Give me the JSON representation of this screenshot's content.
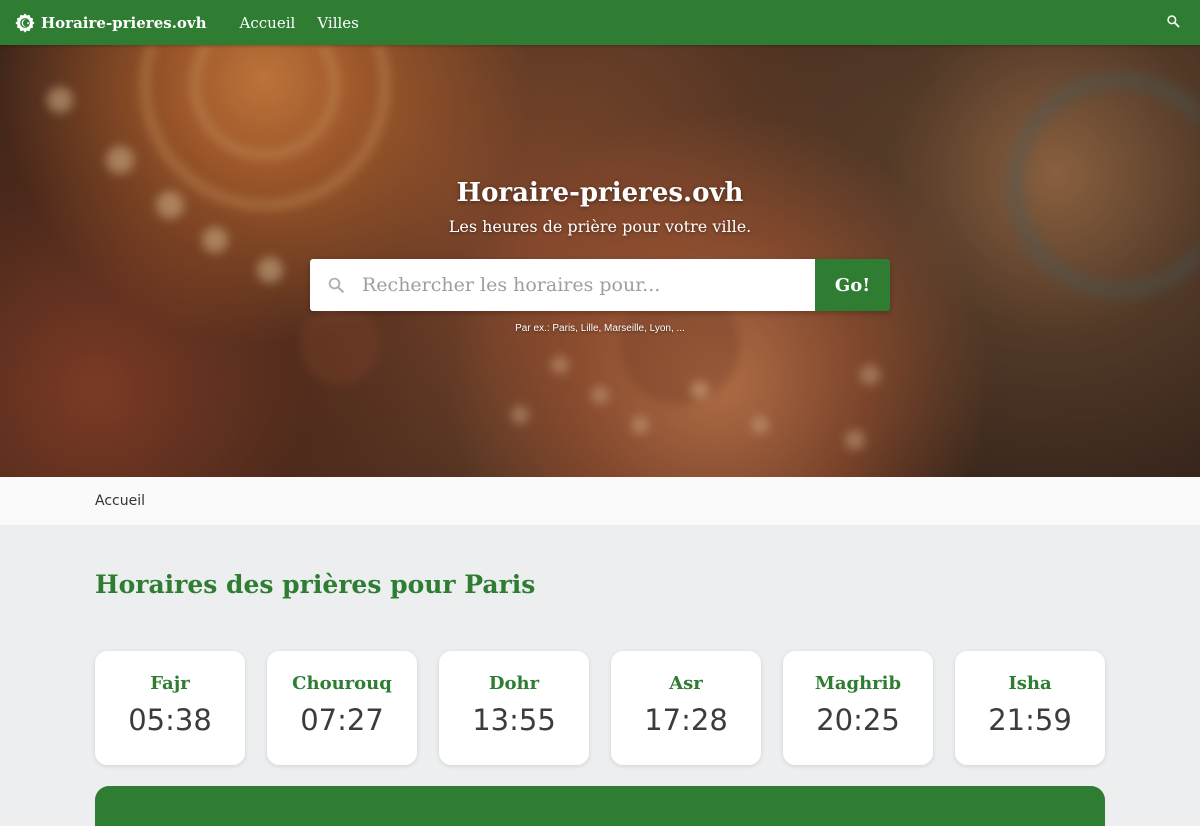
{
  "navbar": {
    "brand": "Horaire-prieres.ovh",
    "links": [
      "Accueil",
      "Villes"
    ],
    "icons": {
      "brand": "gear-logo-icon",
      "search": "search-icon"
    }
  },
  "hero": {
    "title": "Horaire-prieres.ovh",
    "subtitle": "Les heures de prière pour votre ville.",
    "search": {
      "placeholder": "Rechercher les horaires pour...",
      "value": "",
      "button_label": "Go!"
    },
    "hint": "Par ex.: Paris, Lille, Marseille, Lyon, ..."
  },
  "breadcrumb": [
    "Accueil"
  ],
  "main": {
    "title": "Horaires des prières pour Paris",
    "prayers": [
      {
        "name": "Fajr",
        "time": "05:38"
      },
      {
        "name": "Chourouq",
        "time": "07:27"
      },
      {
        "name": "Dohr",
        "time": "13:55"
      },
      {
        "name": "Asr",
        "time": "17:28"
      },
      {
        "name": "Maghrib",
        "time": "20:25"
      },
      {
        "name": "Isha",
        "time": "21:59"
      }
    ]
  },
  "colors": {
    "primary": "#2e7d32",
    "background": "#eceef0",
    "card": "#ffffff"
  }
}
